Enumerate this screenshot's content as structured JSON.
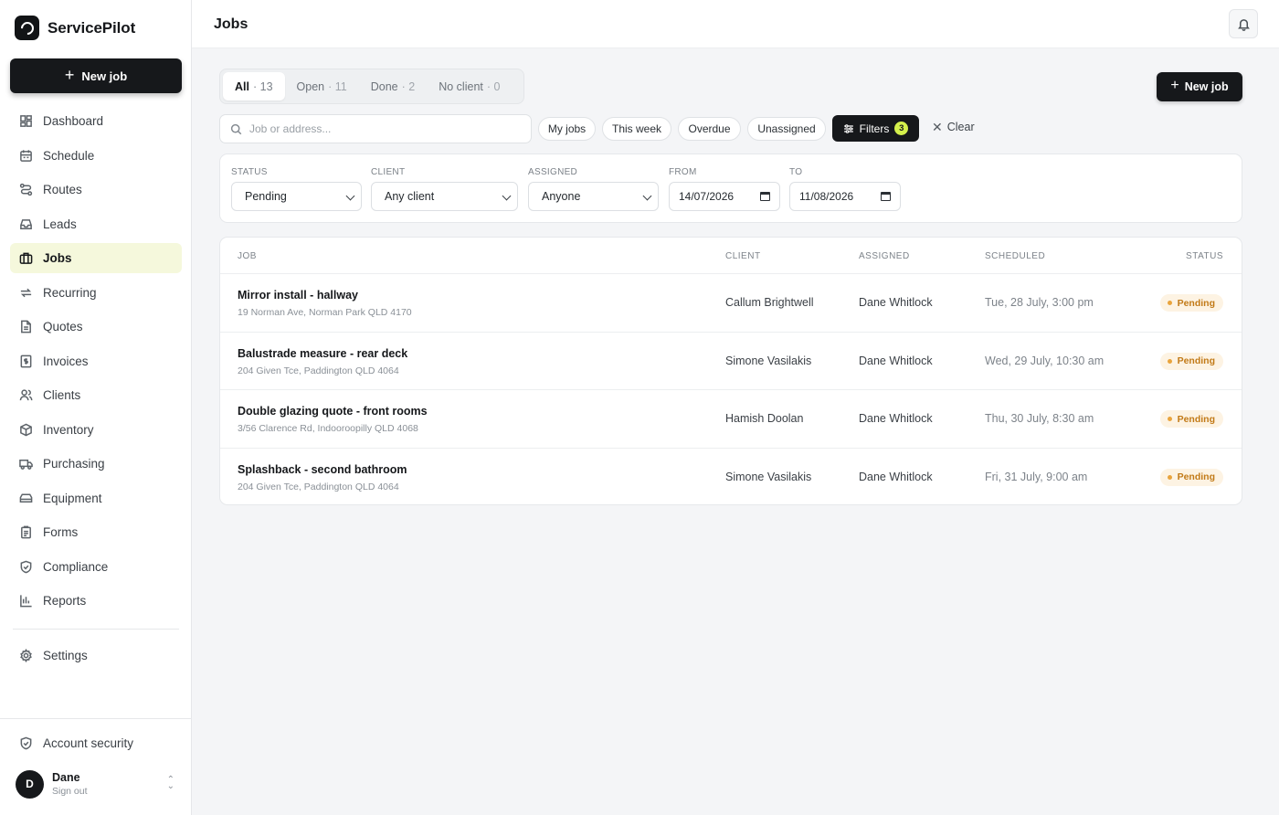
{
  "app": {
    "name": "ServicePilot"
  },
  "sidebar": {
    "new_job_label": "New job",
    "items": [
      {
        "label": "Dashboard",
        "icon": "dashboard-icon"
      },
      {
        "label": "Schedule",
        "icon": "calendar-icon"
      },
      {
        "label": "Routes",
        "icon": "routes-icon"
      },
      {
        "label": "Leads",
        "icon": "inbox-icon"
      },
      {
        "label": "Jobs",
        "icon": "briefcase-icon",
        "active": true
      },
      {
        "label": "Recurring",
        "icon": "repeat-icon"
      },
      {
        "label": "Quotes",
        "icon": "document-icon"
      },
      {
        "label": "Invoices",
        "icon": "invoice-icon"
      },
      {
        "label": "Clients",
        "icon": "users-icon"
      },
      {
        "label": "Inventory",
        "icon": "box-icon"
      },
      {
        "label": "Purchasing",
        "icon": "truck-icon"
      },
      {
        "label": "Equipment",
        "icon": "equipment-icon"
      },
      {
        "label": "Forms",
        "icon": "clipboard-icon"
      },
      {
        "label": "Compliance",
        "icon": "shield-check-icon"
      },
      {
        "label": "Reports",
        "icon": "bar-chart-icon"
      }
    ],
    "settings_label": "Settings",
    "account_security_label": "Account security",
    "user": {
      "initial": "D",
      "name": "Dane",
      "sub": "Sign out"
    }
  },
  "header": {
    "title": "Jobs"
  },
  "tabs": [
    {
      "label": "All",
      "count": "· 13",
      "active": true
    },
    {
      "label": "Open",
      "count": "· 11"
    },
    {
      "label": "Done",
      "count": "· 2"
    },
    {
      "label": "No client",
      "count": "· 0"
    }
  ],
  "toolbar": {
    "new_job_label": "New job",
    "search_placeholder": "Job or address...",
    "chips": [
      "My jobs",
      "This week",
      "Overdue",
      "Unassigned"
    ],
    "filters_label": "Filters",
    "filters_count": "3",
    "clear_label": "Clear"
  },
  "filters": {
    "status": {
      "label": "Status",
      "value": "Pending"
    },
    "client": {
      "label": "Client",
      "value": "Any client"
    },
    "assigned": {
      "label": "Assigned",
      "value": "Anyone"
    },
    "from": {
      "label": "From",
      "value": "14/07/2026"
    },
    "to": {
      "label": "To",
      "value": "11/08/2026"
    }
  },
  "table": {
    "columns": {
      "job": "Job",
      "client": "Client",
      "assigned": "Assigned",
      "scheduled": "Scheduled",
      "status": "Status"
    },
    "rows": [
      {
        "title": "Mirror install - hallway",
        "address": "19 Norman Ave, Norman Park QLD 4170",
        "client": "Callum Brightwell",
        "assigned": "Dane Whitlock",
        "scheduled": "Tue, 28 July, 3:00 pm",
        "status": "Pending"
      },
      {
        "title": "Balustrade measure - rear deck",
        "address": "204 Given Tce, Paddington QLD 4064",
        "client": "Simone Vasilakis",
        "assigned": "Dane Whitlock",
        "scheduled": "Wed, 29 July, 10:30 am",
        "status": "Pending"
      },
      {
        "title": "Double glazing quote - front rooms",
        "address": "3/56 Clarence Rd, Indooroopilly QLD 4068",
        "client": "Hamish Doolan",
        "assigned": "Dane Whitlock",
        "scheduled": "Thu, 30 July, 8:30 am",
        "status": "Pending"
      },
      {
        "title": "Splashback - second bathroom",
        "address": "204 Given Tce, Paddington QLD 4064",
        "client": "Simone Vasilakis",
        "assigned": "Dane Whitlock",
        "scheduled": "Fri, 31 July, 9:00 am",
        "status": "Pending"
      }
    ]
  },
  "colors": {
    "brand_dark": "#16181b",
    "active_nav_bg": "#f5f8dc",
    "badge_accent": "#d4f04c",
    "pending_bg": "#fdf3e3",
    "pending_text": "#c27a17"
  }
}
